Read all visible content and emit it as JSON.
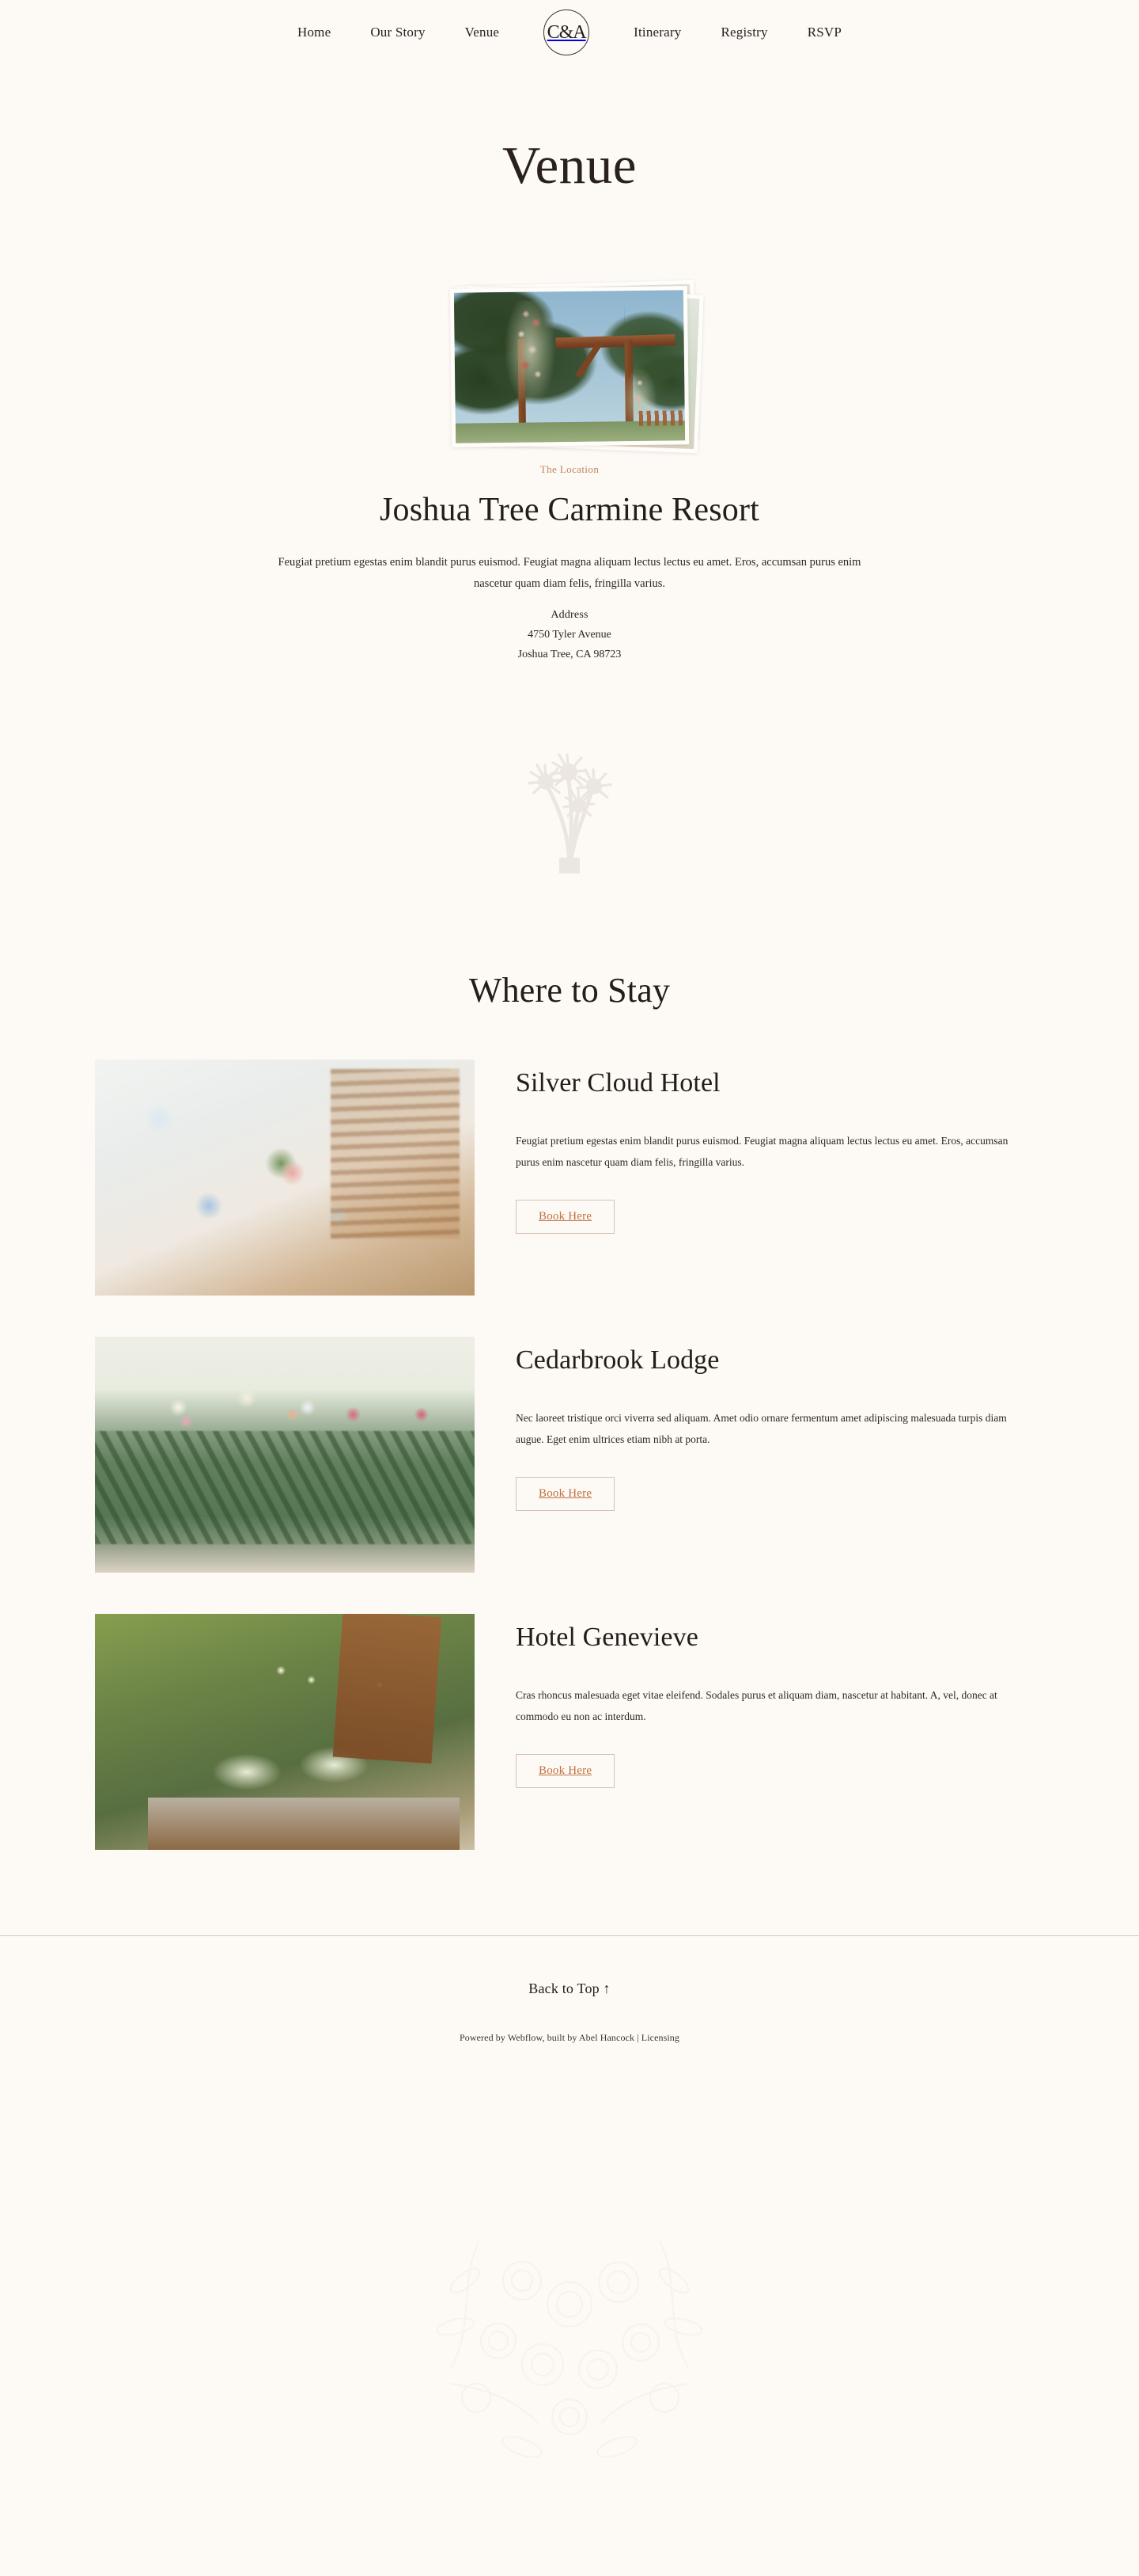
{
  "site": {
    "background_color": "#FDFAF6",
    "accent_color": "#C0703F",
    "eyebrow_color": "#C0825A",
    "text_color": "#2B2320"
  },
  "nav": {
    "left_items": [
      {
        "label": "Home"
      },
      {
        "label": "Our Story"
      },
      {
        "label": "Venue"
      }
    ],
    "logo": {
      "text": "C&A",
      "icon": "monogram-circle-icon"
    },
    "right_items": [
      {
        "label": "Itinerary"
      },
      {
        "label": "Registry"
      },
      {
        "label": "RSVP"
      }
    ]
  },
  "page": {
    "title": "Venue"
  },
  "hero": {
    "photos": [
      {
        "alt": "wedding-photo-back"
      },
      {
        "alt": "wedding-photo-middle"
      },
      {
        "alt": "floral-wedding-arch-photo"
      }
    ]
  },
  "location": {
    "eyebrow": "The Location",
    "name": "Joshua Tree Carmine Resort",
    "description": "Feugiat pretium egestas enim blandit purus euismod. Feugiat magna aliquam lectus lectus eu amet. Eros, accumsan purus enim nascetur quam diam felis, fringilla varius.",
    "address_label": "Address",
    "address_line1": "4750 Tyler Avenue",
    "address_line2": "Joshua Tree, CA 98723",
    "ornament_icon": "joshua-tree-icon"
  },
  "stay": {
    "title": "Where to Stay",
    "hotels": [
      {
        "name": "Silver Cloud Hotel",
        "description": "Feugiat pretium egestas enim blandit purus euismod. Feugiat magna aliquam lectus lectus eu amet. Eros, accumsan purus enim nascetur quam diam felis, fringilla varius.",
        "button_label": "Book Here",
        "image_alt": "wedding-table-setting-photo"
      },
      {
        "name": "Cedarbrook Lodge",
        "description": "Nec laoreet tristique orci viverra sed aliquam. Amet odio ornare fermentum amet adipiscing malesuada turpis diam augue. Eget enim ultrices etiam nibh at porta.",
        "button_label": "Book Here",
        "image_alt": "bridal-bouquets-photo"
      },
      {
        "name": "Hotel Genevieve",
        "description": "Cras rhoncus malesuada eget vitae eleifend. Sodales purus et aliquam diam, nascetur at habitant. A, vel, donec at commodo eu non ac interdum.",
        "button_label": "Book Here",
        "image_alt": "champagne-coupes-photo"
      }
    ]
  },
  "footer": {
    "back_to_top": "Back to Top ↑",
    "credits_prefix": "Powered by Webflow, built by Abel Hancock | ",
    "licensing_label": "Licensing"
  }
}
